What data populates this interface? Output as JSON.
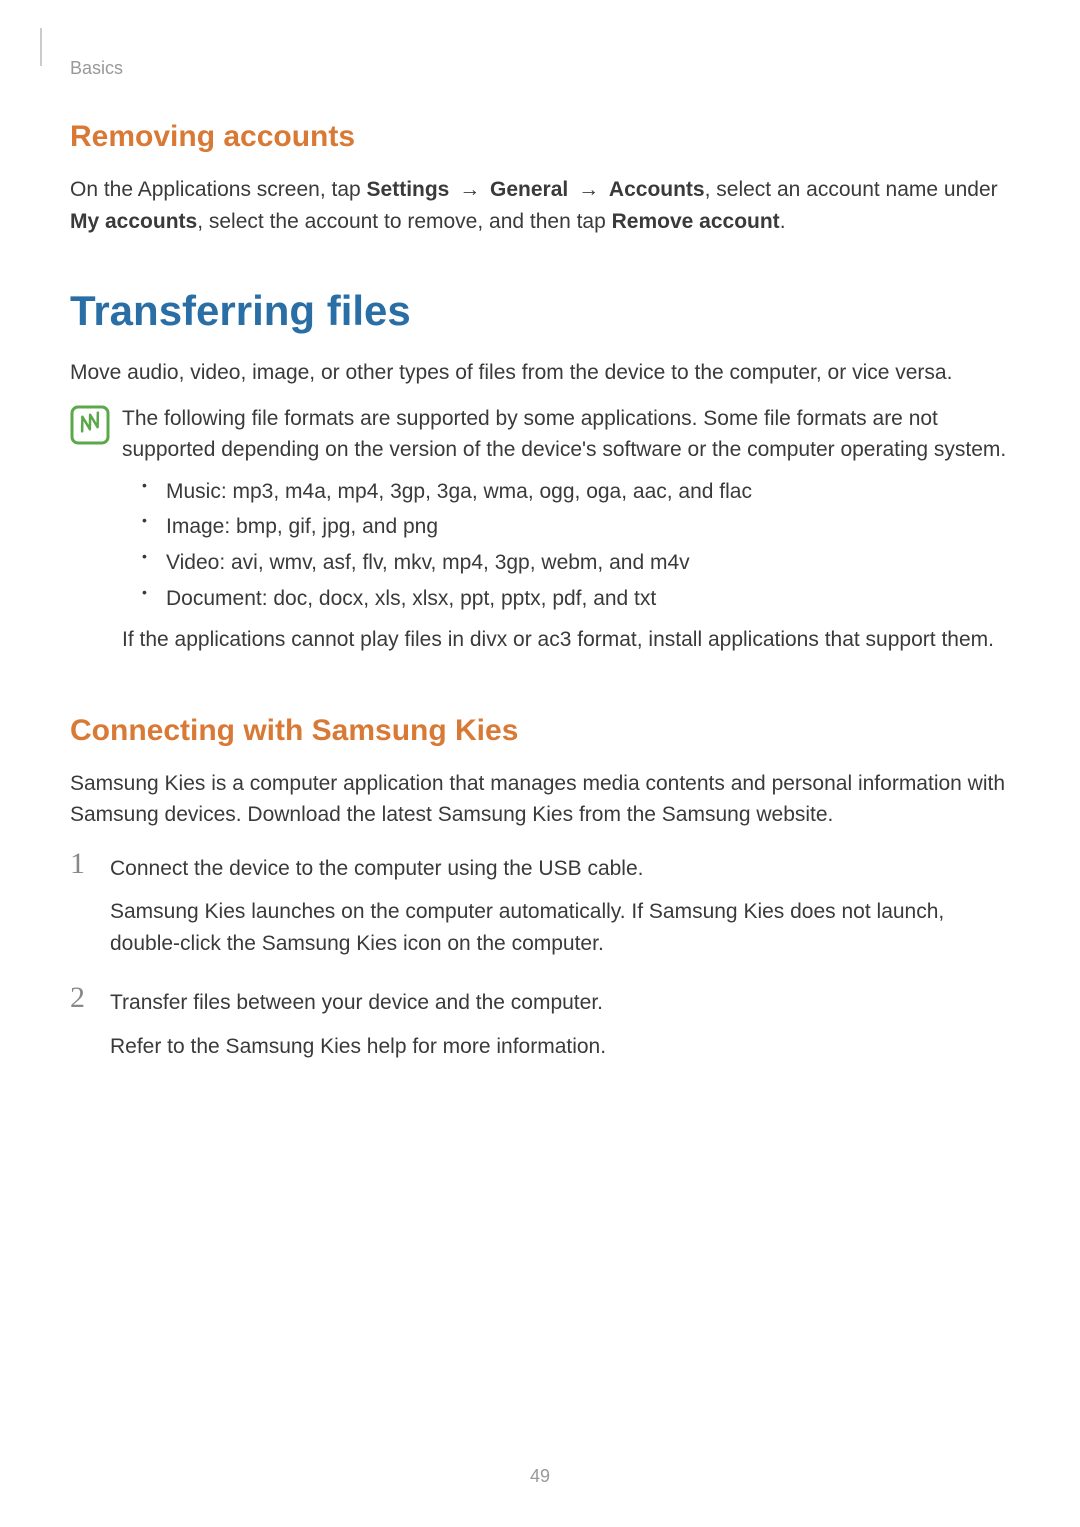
{
  "header": {
    "section_label": "Basics"
  },
  "removing_accounts": {
    "heading": "Removing accounts",
    "p1_a": "On the Applications screen, tap ",
    "p1_b": "Settings",
    "p1_c": " → ",
    "p1_d": "General",
    "p1_e": " → ",
    "p1_f": "Accounts",
    "p1_g": ", select an account name under ",
    "p1_h": "My accounts",
    "p1_i": ", select the account to remove, and then tap ",
    "p1_j": "Remove account",
    "p1_k": "."
  },
  "transferring_files": {
    "heading": "Transferring files",
    "intro": "Move audio, video, image, or other types of files from the device to the computer, or vice versa.",
    "note_p1": "The following file formats are supported by some applications. Some file formats are not supported depending on the version of the device's software or the computer operating system.",
    "bullets": {
      "music": "Music: mp3, m4a, mp4, 3gp, 3ga, wma, ogg, oga, aac, and flac",
      "image": "Image: bmp, gif, jpg, and png",
      "video": "Video: avi, wmv, asf, flv, mkv, mp4, 3gp, webm, and m4v",
      "document": "Document: doc, docx, xls, xlsx, ppt, pptx, pdf, and txt"
    },
    "note_p2": "If the applications cannot play files in divx or ac3 format, install applications that support them."
  },
  "connecting_kies": {
    "heading": "Connecting with Samsung Kies",
    "intro": "Samsung Kies is a computer application that manages media contents and personal information with Samsung devices. Download the latest Samsung Kies from the Samsung website.",
    "steps": {
      "s1_num": "1",
      "s1_main": "Connect the device to the computer using the USB cable.",
      "s1_sub": "Samsung Kies launches on the computer automatically. If Samsung Kies does not launch, double-click the Samsung Kies icon on the computer.",
      "s2_num": "2",
      "s2_main": "Transfer files between your device and the computer.",
      "s2_sub": "Refer to the Samsung Kies help for more information."
    }
  },
  "page_number": "49"
}
